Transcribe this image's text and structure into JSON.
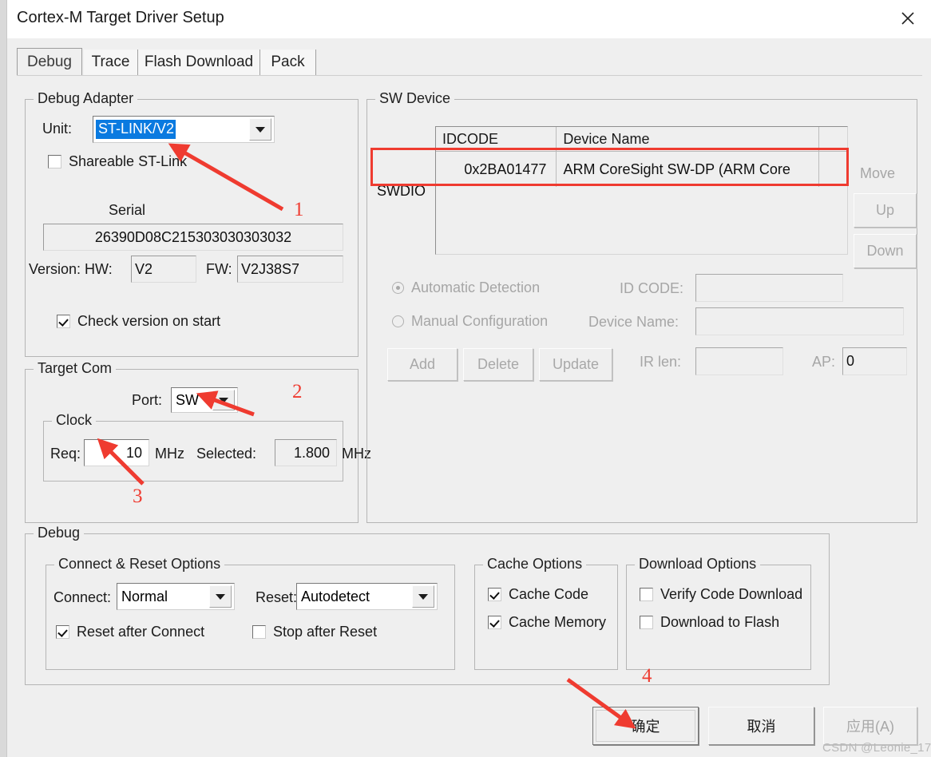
{
  "window": {
    "title": "Cortex-M Target Driver Setup",
    "close_icon": "close-icon"
  },
  "tabs": [
    {
      "label": "Debug",
      "active": true
    },
    {
      "label": "Trace",
      "active": false
    },
    {
      "label": "Flash Download",
      "active": false
    },
    {
      "label": "Pack",
      "active": false
    }
  ],
  "debug_adapter": {
    "legend": "Debug Adapter",
    "unit_label": "Unit:",
    "unit_value": "ST-LINK/V2",
    "shareable_label": "Shareable ST-Link",
    "shareable_checked": false,
    "serial_label": "Serial",
    "serial_value": "26390D08C215303030303032",
    "version_label": "Version: HW:",
    "hw_value": "V2",
    "fw_label": "FW:",
    "fw_value": "V2J38S7",
    "check_version_label": "Check version on start",
    "check_version_checked": true
  },
  "target_com": {
    "legend": "Target Com",
    "port_label": "Port:",
    "port_value": "SW",
    "clock_legend": "Clock",
    "req_label": "Req:",
    "req_value": "10",
    "req_unit": "MHz",
    "selected_label": "Selected:",
    "selected_value": "1.800",
    "selected_unit": "MHz"
  },
  "sw_device": {
    "legend": "SW Device",
    "columns": [
      "IDCODE",
      "Device Name",
      ""
    ],
    "row_label": "SWDIO",
    "rows": [
      {
        "idcode": "0x2BA01477",
        "device_name": "ARM CoreSight SW-DP (ARM Core"
      }
    ],
    "move_label": "Move",
    "up_label": "Up",
    "down_label": "Down",
    "automatic_detection_label": "Automatic Detection",
    "automatic_detection_selected": true,
    "manual_configuration_label": "Manual Configuration",
    "manual_configuration_selected": false,
    "idcode_label": "ID CODE:",
    "idcode_value": "",
    "device_name_label": "Device Name:",
    "device_name_value": "",
    "add_label": "Add",
    "delete_label": "Delete",
    "update_label": "Update",
    "irlen_label": "IR len:",
    "irlen_value": "",
    "ap_label": "AP:",
    "ap_value": "0"
  },
  "debug_section": {
    "legend": "Debug",
    "connect_reset": {
      "legend": "Connect & Reset Options",
      "connect_label": "Connect:",
      "connect_value": "Normal",
      "reset_label": "Reset:",
      "reset_value": "Autodetect",
      "reset_after_connect_label": "Reset after Connect",
      "reset_after_connect_checked": true,
      "stop_after_reset_label": "Stop after Reset",
      "stop_after_reset_checked": false
    },
    "cache": {
      "legend": "Cache Options",
      "cache_code_label": "Cache Code",
      "cache_code_checked": true,
      "cache_memory_label": "Cache Memory",
      "cache_memory_checked": true
    },
    "download": {
      "legend": "Download Options",
      "verify_code_download_label": "Verify Code Download",
      "verify_code_download_checked": false,
      "download_to_flash_label": "Download to Flash",
      "download_to_flash_checked": false
    }
  },
  "footer": {
    "ok_label": "确定",
    "cancel_label": "取消",
    "apply_label": "应用(A)",
    "apply_enabled": false
  },
  "annotations": {
    "color": "#ef3b30",
    "markers": [
      {
        "number": "1",
        "target": "unit-combobox"
      },
      {
        "number": "2",
        "target": "port-combobox"
      },
      {
        "number": "3",
        "target": "clock-req-field"
      },
      {
        "number": "4",
        "target": "ok-button"
      }
    ]
  },
  "watermark": "CSDN @Leonie_17"
}
